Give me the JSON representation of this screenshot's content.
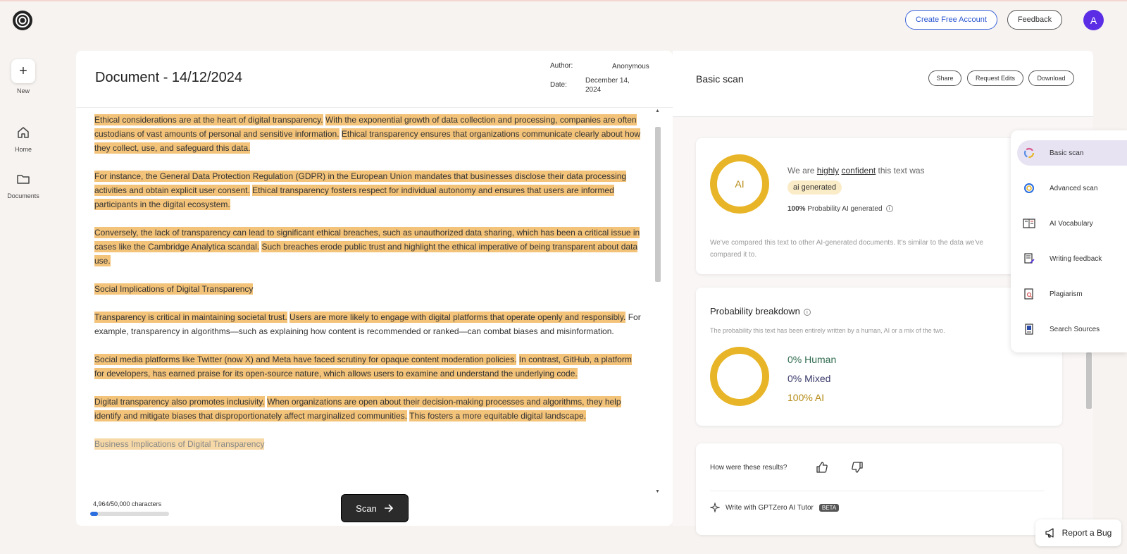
{
  "header": {
    "create_account": "Create Free Account",
    "feedback": "Feedback",
    "avatar_initial": "A"
  },
  "sidebar": {
    "new_label": "New",
    "items": [
      {
        "label": "Home",
        "icon": "home-icon"
      },
      {
        "label": "Documents",
        "icon": "folder-icon"
      }
    ]
  },
  "document": {
    "title": "Document - 14/12/2024",
    "author_label": "Author:",
    "author_value": "Anonymous",
    "date_label": "Date:",
    "date_value_1": "December 14,",
    "date_value_2": "2024",
    "paragraphs": [
      [
        {
          "text": "Ethical considerations are at the heart of digital transparency.",
          "hl": true
        },
        {
          "text": " ",
          "hl": false
        },
        {
          "text": "With the exponential growth of data collection and processing, companies are often custodians of vast amounts of personal and sensitive information.",
          "hl": true
        },
        {
          "text": " ",
          "hl": false
        },
        {
          "text": "Ethical transparency ensures that organizations communicate clearly about how they collect, use, and safeguard this data.",
          "hl": true
        }
      ],
      [
        {
          "text": "For instance, the General Data Protection Regulation (GDPR) in the European Union mandates that businesses disclose their data processing activities and obtain explicit user consent.",
          "hl": true
        },
        {
          "text": " ",
          "hl": false
        },
        {
          "text": "Ethical transparency fosters respect for individual autonomy and ensures that users are informed participants in the digital ecosystem.",
          "hl": true
        }
      ],
      [
        {
          "text": "Conversely, the lack of transparency can lead to significant ethical breaches, such as unauthorized data sharing, which has been a critical issue in cases like the Cambridge Analytica scandal.",
          "hl": true
        },
        {
          "text": " ",
          "hl": false
        },
        {
          "text": "Such breaches erode public trust and highlight the ethical imperative of being transparent about data use.",
          "hl": true
        }
      ],
      [
        {
          "text": "Social Implications of Digital Transparency",
          "hl": true
        }
      ],
      [
        {
          "text": "Transparency is critical in maintaining societal trust.",
          "hl": true
        },
        {
          "text": " ",
          "hl": false
        },
        {
          "text": "Users are more likely to engage with digital platforms that operate openly and responsibly.",
          "hl": true
        },
        {
          "text": " For example, transparency in algorithms—such as explaining how content is recommended or ranked—can combat biases and misinformation.",
          "hl": false
        }
      ],
      [
        {
          "text": "Social media platforms like Twitter (now X) and Meta have faced scrutiny for opaque content moderation policies.",
          "hl": true
        },
        {
          "text": " ",
          "hl": false
        },
        {
          "text": "In contrast, GitHub, a platform for developers, has earned praise for its open-source nature, which allows users to examine and understand the underlying code.",
          "hl": true
        }
      ],
      [
        {
          "text": "Digital transparency also promotes inclusivity.",
          "hl": true
        },
        {
          "text": " ",
          "hl": false
        },
        {
          "text": "When organizations are open about their decision-making processes and algorithms, they help identify and mitigate biases that disproportionately affect marginalized communities.",
          "hl": true
        },
        {
          "text": " ",
          "hl": false
        },
        {
          "text": "This fosters a more equitable digital landscape.",
          "hl": true
        }
      ],
      [
        {
          "text": "Business Implications of Digital Transparency",
          "hl": "faded"
        }
      ]
    ],
    "char_count": "4,964/50,000 characters",
    "char_fraction": 0.099,
    "scan_label": "Scan"
  },
  "results": {
    "title": "Basic scan",
    "share": "Share",
    "request_edits": "Request Edits",
    "download": "Download",
    "confidence_prefix": "We are ",
    "confidence_word_1": "highly",
    "confidence_word_2": "confident",
    "confidence_suffix": " this text was",
    "ring_label": "AI",
    "badge": "ai generated",
    "prob_value": "100%",
    "prob_label": " Probability AI generated",
    "compare_text": "We've compared this text to other AI-generated documents. It's similar to the data we've compared it to.",
    "breakdown_title": "Probability breakdown",
    "breakdown_sub": "The probability this text has been entirely written by a human, AI or a mix of the two.",
    "human": "0% Human",
    "mixed": "0% Mixed",
    "ai": "100% AI",
    "feedback_question": "How were these results?",
    "tutor": "Write with GPTZero AI Tutor",
    "beta": "BETA"
  },
  "tools": [
    {
      "label": "Basic scan",
      "icon": "basic-scan-icon",
      "active": true
    },
    {
      "label": "Advanced scan",
      "icon": "advanced-scan-icon",
      "active": false
    },
    {
      "label": "AI Vocabulary",
      "icon": "vocabulary-icon",
      "active": false
    },
    {
      "label": "Writing feedback",
      "icon": "writing-feedback-icon",
      "active": false
    },
    {
      "label": "Plagiarism",
      "icon": "plagiarism-icon",
      "active": false
    },
    {
      "label": "Search Sources",
      "icon": "search-sources-icon",
      "active": false
    }
  ],
  "report_bug": "Report a Bug",
  "colors": {
    "highlight": "#f3c37a",
    "ring": "#e8b528",
    "human": "#2f6b4f",
    "mixed": "#3b3b6b",
    "ai": "#b58b16",
    "accent": "#5b2ee6"
  }
}
